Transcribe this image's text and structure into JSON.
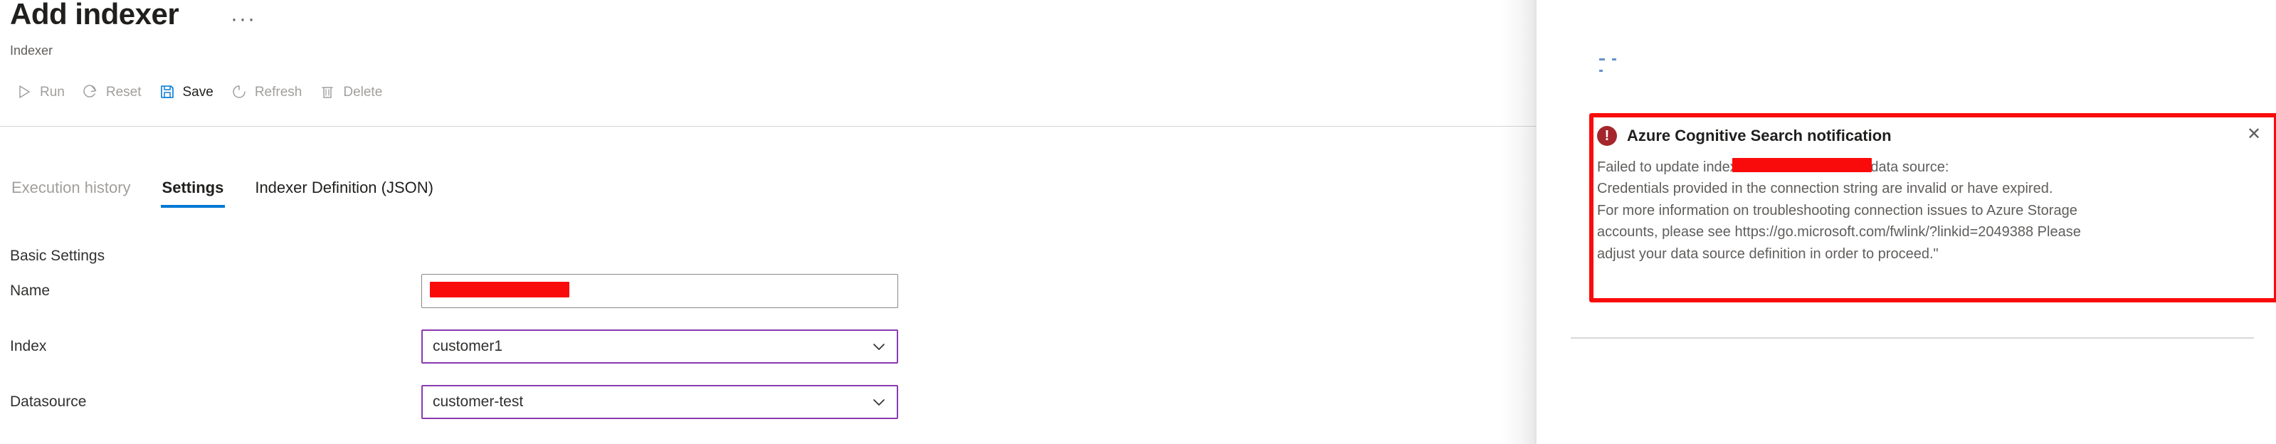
{
  "blade": {
    "title": "Add indexer",
    "subtitle": "Indexer",
    "more_menu": "···",
    "more_menu_icon": "ellipsis-icon"
  },
  "command_bar": {
    "items": [
      {
        "label": "Run",
        "icon": "play-icon",
        "enabled": false
      },
      {
        "label": "Reset",
        "icon": "reset-icon",
        "enabled": false
      },
      {
        "label": "Save",
        "icon": "save-icon",
        "enabled": true
      },
      {
        "label": "Refresh",
        "icon": "refresh-icon",
        "enabled": false
      },
      {
        "label": "Delete",
        "icon": "trash-icon",
        "enabled": false
      }
    ]
  },
  "tabs": [
    {
      "label": "Execution history",
      "state": "muted"
    },
    {
      "label": "Settings",
      "state": "active"
    },
    {
      "label": "Indexer Definition (JSON)",
      "state": "normal"
    }
  ],
  "form": {
    "section_label": "Basic Settings",
    "fields": [
      {
        "label": "Name",
        "value": "",
        "control": "textbox",
        "redacted": true
      },
      {
        "label": "Index",
        "value": "customer1",
        "control": "dropdown",
        "redacted": false
      },
      {
        "label": "Datasource",
        "value": "customer-test",
        "control": "dropdown",
        "redacted": false
      }
    ]
  },
  "notification": {
    "title": "Azure Cognitive Search notification",
    "icon": "error-icon",
    "close_label": "✕",
    "message": "Failed to update indexer \"                                  error: \"Error with data source:\nCredentials provided in the connection string are invalid or have expired.\nFor more information on troubleshooting connection issues to Azure Storage\naccounts, please see https://go.microsoft.com/fwlink/?linkid=2049388  Please\nadjust your data source definition in order to proceed.\"",
    "footer_ghost": ""
  },
  "colors": {
    "accent": "#0078d4",
    "error": "#a4262c",
    "annotation": "#fa0b0b",
    "dropdown_border": "#8a3ab0",
    "text_primary": "#201f1e",
    "text_secondary": "#605e5c",
    "text_disabled": "#a19f9d"
  }
}
